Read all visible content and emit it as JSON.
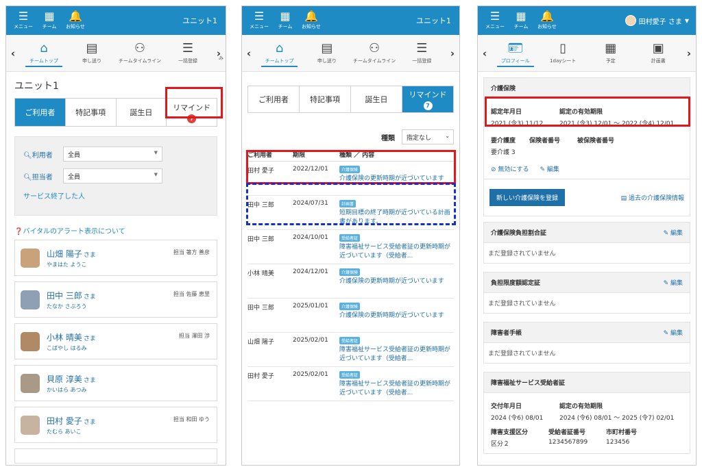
{
  "topbar": {
    "menu_label": "メニュー",
    "team_label": "チーム",
    "notice_label": "お知らせ",
    "unit_label": "ユニット1",
    "user_label": "田村愛子 さま"
  },
  "nav1": {
    "items": [
      "チームトップ",
      "申し送り",
      "チームタイムライン",
      "一括登録"
    ],
    "more": "み"
  },
  "nav3": {
    "items": [
      "プロフィール",
      "1dayシート",
      "予定",
      "計画書"
    ]
  },
  "panel1": {
    "title": "ユニット1",
    "tabs": [
      "ご利用者",
      "特記事項",
      "誕生日",
      "リマインド"
    ],
    "badge": "7",
    "filter": {
      "user_label": "利用者",
      "user_value": "全員",
      "staff_label": "担当者",
      "staff_value": "全員",
      "ended_link": "サービス終了した人"
    },
    "alert_link": "バイタルのアラート表示について",
    "residents": [
      {
        "name": "山畑 陽子",
        "sama": "さま",
        "kana": "やまはた ようこ",
        "staff": "担当 箸方 善彦"
      },
      {
        "name": "田中 三郎",
        "sama": "さま",
        "kana": "たなか さぶろう",
        "staff": "担当 佐藤 恵里"
      },
      {
        "name": "小林 晴美",
        "sama": "さま",
        "kana": "こばやし はるみ",
        "staff": "担当 澤田 渉"
      },
      {
        "name": "貝原 淳美",
        "sama": "さま",
        "kana": "かいはら あつみ",
        "staff": ""
      },
      {
        "name": "田村 愛子",
        "sama": "さま",
        "kana": "たむら あいこ",
        "staff": "担当 和田 ゆう"
      }
    ]
  },
  "panel2": {
    "tabs": [
      "ご利用者",
      "特記事項",
      "誕生日",
      "リマインド"
    ],
    "badge": "7",
    "sort_label": "種類",
    "sort_value": "指定なし",
    "headers": [
      "ご利用者",
      "期限",
      "種類 ／ 内容"
    ],
    "rows": [
      {
        "user": "田村 愛子",
        "date": "2022/12/01",
        "tag": "介護保険",
        "text": "介護保険の更新時期が近づいています"
      },
      {
        "user": "田中 三郎",
        "date": "2024/07/31",
        "tag": "計画書",
        "text": "短期目標の終了時期が近づいている計画書があります。"
      },
      {
        "user": "田中 三郎",
        "date": "2024/10/01",
        "tag": "受給者証",
        "text": "障害福祉サービス受給者証の更新時期が近づいています（受給者..."
      },
      {
        "user": "小林 晴美",
        "date": "2024/12/01",
        "tag": "介護保険",
        "text": "介護保険の更新時期が近づいています"
      },
      {
        "user": "田中 三郎",
        "date": "2025/01/01",
        "tag": "介護保険",
        "text": "介護保険の更新時期が近づいています"
      },
      {
        "user": "山畑 陽子",
        "date": "2025/02/01",
        "tag": "受給者証",
        "text": "障害福祉サービス受給者証の更新時期が近づいています（受給者..."
      },
      {
        "user": "田村 愛子",
        "date": "2025/02/01",
        "tag": "受給者証",
        "text": "障害福祉サービス受給者証の更新時期が近づいています（受給者..."
      }
    ]
  },
  "panel3": {
    "kaigo": {
      "heading": "介護保険",
      "cert_date_label": "認定年月日",
      "cert_date": "2021 (令3) 11/12",
      "valid_label": "認定の有効期限",
      "valid": "2021 (令3) 12/01 〜 2022 (令4) 12/01",
      "care_level_label": "要介護度",
      "insurer_no_label": "保険者番号",
      "insured_no_label": "被保険者番号",
      "care_level": "要介護 3",
      "disable_link": "無効にする",
      "edit_link": "編集",
      "register_button": "新しい介護保険を登録",
      "past_link": "過去の介護保険情報"
    },
    "sections": [
      {
        "title": "介護保険負担割合証",
        "edit": "編集",
        "msg": "まだ登録されていません"
      },
      {
        "title": "負担限度額認定証",
        "edit": "編集",
        "msg": "まだ登録されていません"
      },
      {
        "title": "障害者手帳",
        "edit": "編集",
        "msg": "まだ登録されていません"
      }
    ],
    "shogai": {
      "heading": "障害福祉サービス受給者証",
      "issue_label": "交付年月日",
      "issue": "2024 (令6) 08/01",
      "valid_label": "認定の有効期限",
      "valid": "2024 (令6) 08/01 〜 2025 (令7) 02/01",
      "class_label": "障害支援区分",
      "recipient_no_label": "受給者証番号",
      "city_no_label": "市町村番号",
      "class": "区分２",
      "recipient_no": "1234567899",
      "city_no": "123456"
    }
  }
}
